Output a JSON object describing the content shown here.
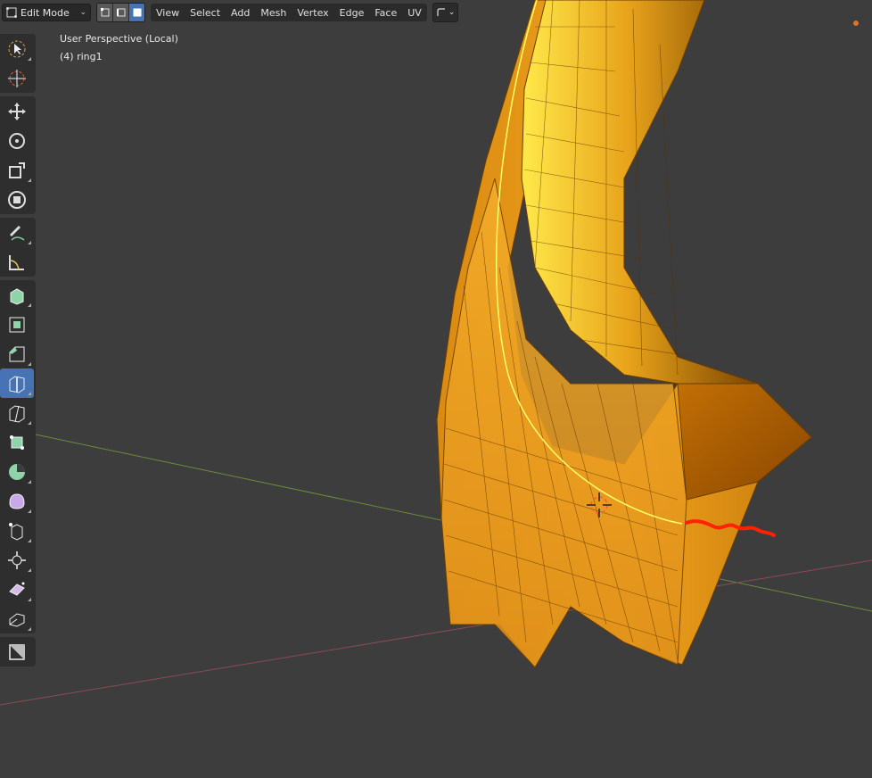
{
  "header": {
    "mode": "Edit Mode",
    "menus": [
      "View",
      "Select",
      "Add",
      "Mesh",
      "Vertex",
      "Edge",
      "Face",
      "UV"
    ]
  },
  "overlay": {
    "perspective": "User Perspective (Local)",
    "object": "(4) ring1"
  },
  "colors": {
    "background": "#3d3d3d",
    "accent": "#4772b3",
    "ring_light": "#ffd21a",
    "ring_dark": "#b36a00",
    "seam": "#ffff66",
    "annotation": "#ff2200"
  },
  "toolbar": {
    "tools": [
      "select-box-icon",
      "cursor-icon",
      "move-icon",
      "rotate-icon",
      "scale-icon",
      "transform-icon",
      "annotate-icon",
      "measure-icon",
      "extrude-icon",
      "inset-icon",
      "bevel-icon",
      "loop-cut-icon",
      "knife-icon",
      "poly-build-icon",
      "spin-icon",
      "smooth-icon",
      "edge-slide-icon",
      "shrink-fatten-icon",
      "shear-icon",
      "rip-icon"
    ]
  }
}
